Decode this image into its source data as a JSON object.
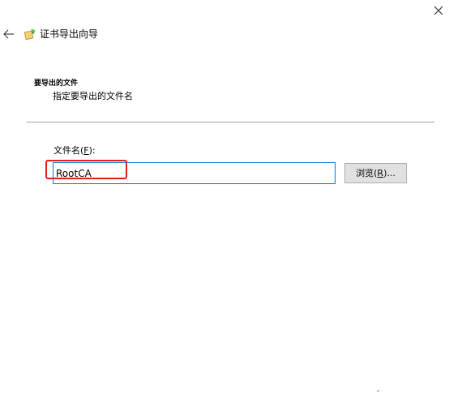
{
  "window": {
    "close_icon": "close-icon",
    "back_icon": "back-arrow-icon",
    "wizard_icon": "certificate-wizard-icon",
    "title": "证书导出向导"
  },
  "section": {
    "heading": "要导出的文件",
    "description": "指定要导出的文件名"
  },
  "file_name": {
    "label_prefix": "文件名(",
    "label_accel": "F",
    "label_suffix": "):",
    "value": "RootCA"
  },
  "browse": {
    "label_prefix": "浏览(",
    "label_accel": "R",
    "label_suffix": ")..."
  },
  "colors": {
    "accent_border": "#0078d7",
    "highlight": "#e02020",
    "button_face": "#e1e1e1"
  }
}
